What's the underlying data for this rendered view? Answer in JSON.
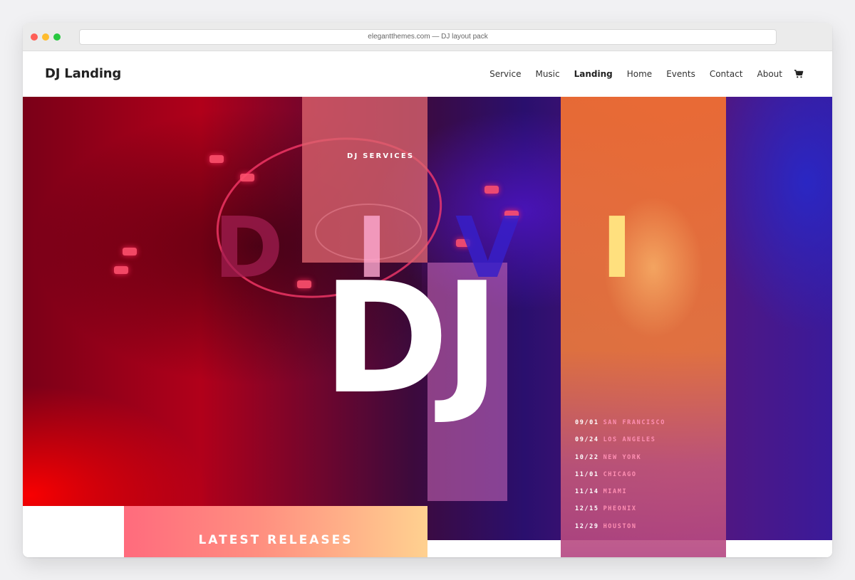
{
  "browser": {
    "url": "elegantthemes.com — DJ layout pack"
  },
  "header": {
    "logo": "DJ Landing",
    "nav": [
      "Service",
      "Music",
      "Landing",
      "Home",
      "Events",
      "Contact",
      "About"
    ],
    "active_nav": "Landing",
    "cart_icon": "cart-icon"
  },
  "hero": {
    "services_label": "DJ SERVICES",
    "divi_letters": [
      "D",
      "I",
      "V",
      "I"
    ],
    "title": "DJ",
    "events": [
      {
        "date": "09/01",
        "city": "SAN FRANCISCO"
      },
      {
        "date": "09/24",
        "city": "LOS ANGELES"
      },
      {
        "date": "10/22",
        "city": "NEW YORK"
      },
      {
        "date": "11/01",
        "city": "CHICAGO"
      },
      {
        "date": "11/14",
        "city": "MIAMI"
      },
      {
        "date": "12/15",
        "city": "PHEONIX"
      },
      {
        "date": "12/29",
        "city": "HOUSTON"
      }
    ],
    "releases_label": "LATEST RELEASES"
  },
  "colors": {
    "accent_orange": "#f0743a",
    "accent_pink": "#ff8fb3",
    "accent_yellow": "#ffe07e",
    "releases_gradient": [
      "#ff6b7d",
      "#ffd190"
    ]
  }
}
